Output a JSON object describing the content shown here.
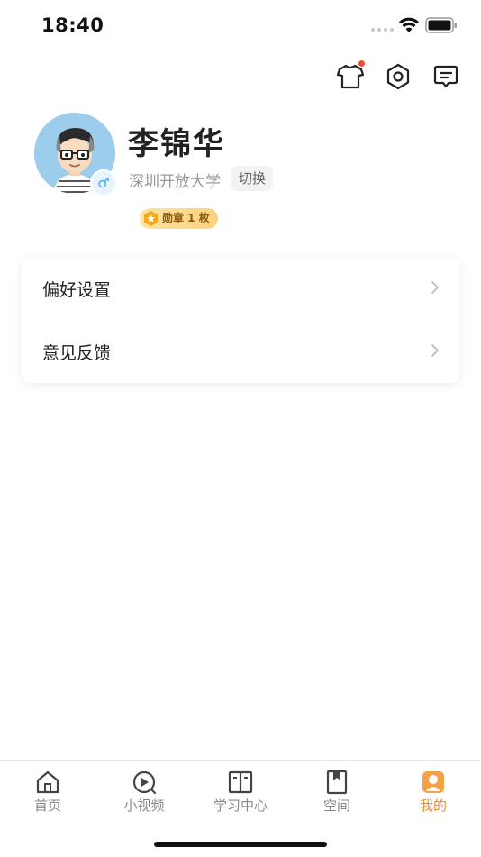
{
  "status_bar": {
    "time": "18:40"
  },
  "top_actions": [
    {
      "icon": "tshirt-icon",
      "has_dot": true
    },
    {
      "icon": "settings-hex-icon",
      "has_dot": false
    },
    {
      "icon": "message-icon",
      "has_dot": false
    }
  ],
  "profile": {
    "name": "李锦华",
    "school": "深圳开放大学",
    "switch_label": "切换",
    "gender_symbol": "♂",
    "medal_label": "勋章 1 枚"
  },
  "menu": {
    "items": [
      {
        "label": "偏好设置"
      },
      {
        "label": "意见反馈"
      }
    ]
  },
  "tab_bar": {
    "tabs": [
      {
        "label": "首页",
        "icon": "home-icon"
      },
      {
        "label": "小视频",
        "icon": "video-icon"
      },
      {
        "label": "学习中心",
        "icon": "book-icon"
      },
      {
        "label": "空间",
        "icon": "bookmark-icon"
      },
      {
        "label": "我的",
        "icon": "profile-icon",
        "active": true
      }
    ]
  },
  "colors": {
    "accent": "#f08a2c",
    "notification": "#f04a32",
    "gender": "#3aa3e8"
  }
}
